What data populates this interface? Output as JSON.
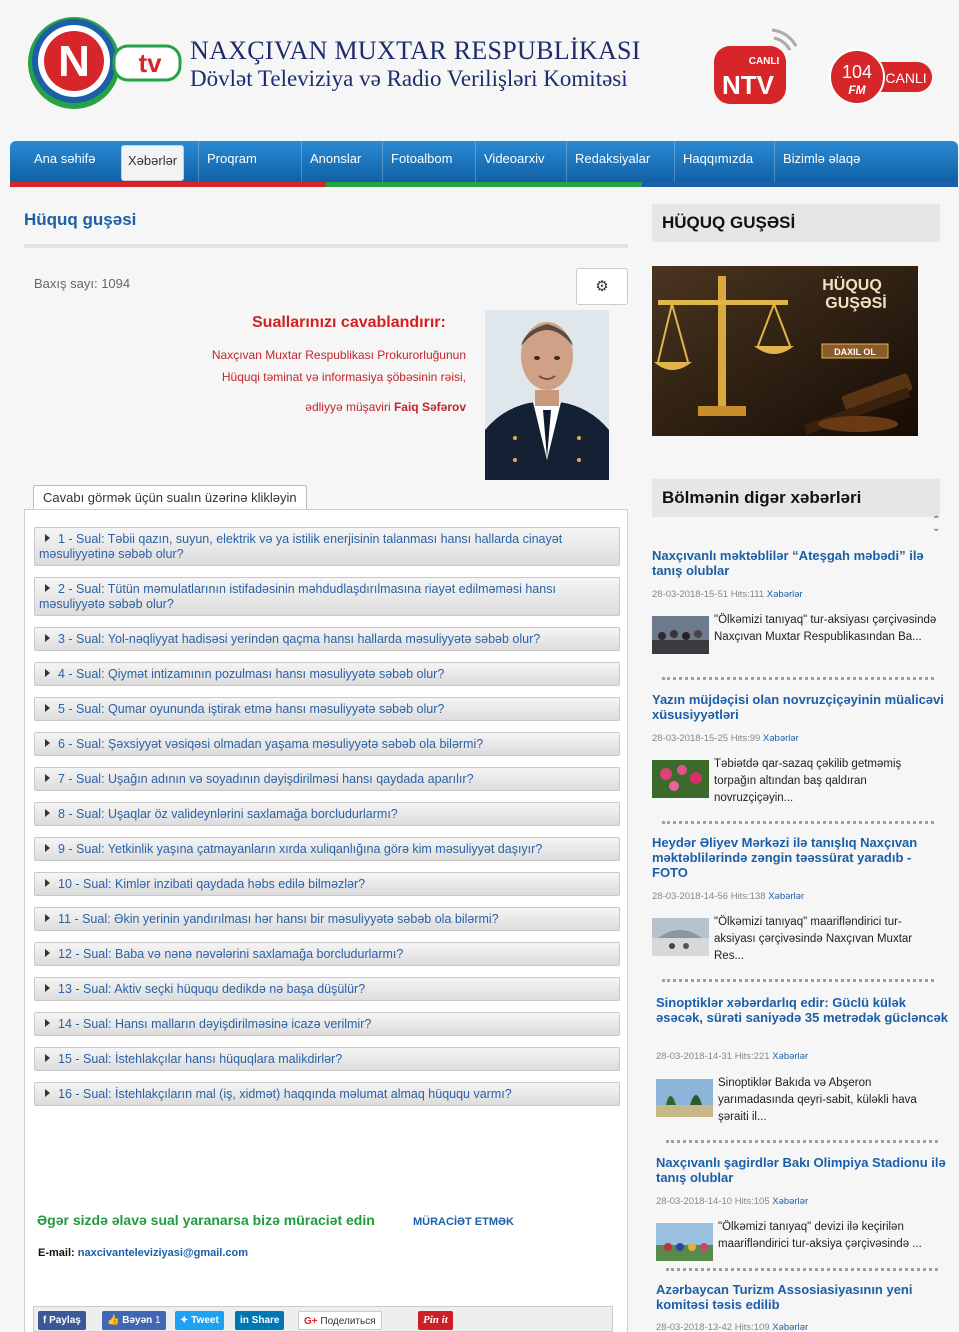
{
  "header": {
    "title_line1": "NAXÇIVAN MUXTAR RESPUBLİKASI",
    "title_line2": "Dövlət Televiziya və Radio Verilişləri Komitəsi",
    "logo_letters": "N",
    "logo_tv": "tv",
    "live_tv_badge": "CANLI",
    "live_tv_letters": "NTV",
    "live_fm_freq": "104",
    "live_fm_label": "FM",
    "live_fm_badge": "CANLI"
  },
  "nav": {
    "items": [
      "Ana səhifə",
      "Xəbərlər",
      "Proqram",
      "Anonslar",
      "Fotoalbom",
      "Videoarxiv",
      "Redaksiyalar",
      "Haqqımızda",
      "Bizimlə əlaqə"
    ],
    "active_index": 1,
    "stripe_colors": [
      "#d6262a",
      "#27a244",
      "#1a5fa8"
    ]
  },
  "main": {
    "title": "Hüquq guşəsi",
    "views": "Baxış sayı: 1094",
    "settings_icon": "gear-icon",
    "answer_heading": "Suallarınızı cavablandırır:",
    "answer_line1": "Naxçıvan Muxtar Respublikası Prokurorluğunun",
    "answer_line2": "Hüquqi təminat və informasiya şöbəsinin rəisi,",
    "answer_line3_prefix": "ədliyyə müşaviri ",
    "answer_name": "Faiq Səfərov",
    "tab_label": "Cavabı görmək üçün sualın üzərinə klikləyin",
    "questions": [
      "1 - Sual: Təbii qazın, suyun, elektrik və ya istilik enerjisinin talanması hansı hallarda cinayət məsuliyyətinə səbəb olur?",
      "2 - Sual: Tütün məmulatlarının istifadəsinin məhdudlaşdırılmasına riayət edilməməsi hansı məsuliyyətə səbəb olur?",
      "3 - Sual: Yol-nəqliyyat hadisəsi yerindən qaçma hansı hallarda məsuliyyətə səbəb olur?",
      "4 - Sual: Qiymət intizamının pozulması hansı məsuliyyətə səbəb olur?",
      "5 - Sual: Qumar oyununda iştirak etmə hansı məsuliyyətə səbəb olur?",
      "6 - Sual: Şəxsiyyət vəsiqəsi olmadan yaşama məsuliyyətə səbəb ola bilərmi?",
      "7 - Sual: Uşağın adının və soyadının dəyişdirilməsi hansı qaydada aparılır?",
      "8 - Sual: Uşaqlar öz valideynlərini saxlamağa borcludurlarmı?",
      "9 - Sual: Yetkinlik yaşına çatmayanların xırda xuliqanlığına görə kim məsuliyyət daşıyır?",
      "10 - Sual: Kimlər inzibati qaydada həbs edilə bilməzlər?",
      "11 - Sual: Əkin yerinin yandırılması hər hansı bir məsuliyyətə səbəb ola bilərmi?",
      "12 - Sual: Baba və nənə nəvələrini saxlamağa borcludurlarmı?",
      "13 - Sual: Aktiv seçki hüququ dedikdə nə başa düşülür?",
      "14 - Sual: Hansı malların dəyişdirilməsinə icazə verilmir?",
      "15 - Sual: İstehlakçılar hansı hüquqlara malikdirlər?",
      "16 - Sual: İstehlakçıların mal (iş, xidmət) haqqında məlumat almaq hüququ varmı?"
    ],
    "contact_text": "Əgər sizdə əlavə sual yaranarsa bizə müraciət edin",
    "contact_link": "MÜRACİƏT ETMƏK",
    "email_label": "E-mail: ",
    "email_value": "naxcivanteleviziyasi@gmail.com",
    "share": {
      "facebook": "Paylaş",
      "like": "Bəyən",
      "like_count": "1",
      "tweet": "Tweet",
      "linkedin": "Share",
      "gplus": "Поделиться",
      "pinterest": "Pin it"
    }
  },
  "sidebar": {
    "block1_title": "HÜQUQ GUŞƏSİ",
    "banner_text1": "HÜQUQ",
    "banner_text2": "GUŞƏSİ",
    "banner_plate": "DAXIL OL",
    "block2_title": "Bölmənin digər xəbərləri",
    "news": [
      {
        "title": "Naxçıvanlı məktəblilər “Ateşgah məbədi” ilə tanış olublar",
        "date": "28-03-2018-15-51",
        "hits": "Hits:111",
        "category": "Xəbərlər",
        "text": "\"Ölkəmizi tanıyaq\" tur-aksiyası çərçivəsində Naxçıvan Muxtar Respublikasından Ba..."
      },
      {
        "title": "Yazın müjdəçisi olan novruzçiçəyinin müalicəvi xüsusiyyətləri",
        "date": "28-03-2018-15-25",
        "hits": "Hits:99",
        "category": "Xəbərlər",
        "text": "Təbiətdə qar-sazaq çəkilib getməmiş torpağın altından baş qaldıran novruzçiçəyin..."
      },
      {
        "title": "Heydər Əliyev Mərkəzi ilə tanışlıq Naxçıvan məktəblilərində zəngin təəssürat yaradıb - FOTO",
        "date": "28-03-2018-14-56",
        "hits": "Hits:138",
        "category": "Xəbərlər",
        "text": "\"Ölkəmizi tanıyaq\" maarifləndirici tur-aksiyası çərçivəsində Naxçıvan Muxtar Res..."
      },
      {
        "title": "Sinoptiklər xəbərdarlıq edir: Güclü külək əsəcək, sürəti saniyədə 35 metrədək gücləncək",
        "date": "28-03-2018-14-31",
        "hits": "Hits:221",
        "category": "Xəbərlər",
        "text": "Sinoptiklər Bakıda və Abşeron yarımadasında qeyri-sabit, küləkli hava şəraiti il..."
      },
      {
        "title": "Naxçıvanlı şagirdlər Bakı Olimpiya Stadionu ilə tanış olublar",
        "date": "28-03-2018-14-10",
        "hits": "Hits:105",
        "category": "Xəbərlər",
        "text": "\"Ölkəmizi tanıyaq\" devizi ilə keçirilən maarifləndirici tur-aksiya çərçivəsində ..."
      },
      {
        "title": "Azərbaycan Turizm Assosiasiyasının yeni komitəsi təsis edilib",
        "date": "28-03-2018-13-42",
        "hits": "Hits:109",
        "category": "Xəbərlər",
        "text": ""
      }
    ]
  }
}
